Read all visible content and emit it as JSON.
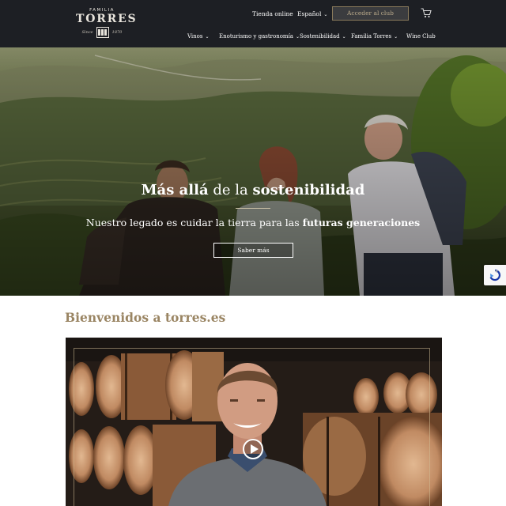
{
  "header": {
    "logo": {
      "line1": "FAMILIA",
      "line2": "TORRES",
      "since": "Since",
      "year": "1870"
    },
    "utility": {
      "online_store": "Tienda online",
      "language": "Español",
      "club_button": "Acceder al club",
      "cart_icon": "cart-icon"
    },
    "nav": [
      {
        "label": "Vinos",
        "has_dropdown": true
      },
      {
        "label": "Enoturismo y gastronomía",
        "has_dropdown": true
      },
      {
        "label": "Sostenibilidad",
        "has_dropdown": true
      },
      {
        "label": "Familia Torres",
        "has_dropdown": true
      },
      {
        "label": "Wine Club",
        "has_dropdown": false
      }
    ]
  },
  "hero": {
    "title_bold": "Más allá",
    "title_mid": " de la ",
    "title_bold2": "sostenibilidad",
    "subtitle_pre": "Nuestro legado es cuidar la tierra para las ",
    "subtitle_bold": "futuras generaciones",
    "button": "Saber más"
  },
  "welcome": {
    "heading": "Bienvenidos a torres.es"
  },
  "video": {
    "play_icon": "play-icon"
  },
  "colors": {
    "header_bg": "#1d1f24",
    "accent_gold": "#9a8563",
    "club_button_text": "#b9a98a"
  }
}
